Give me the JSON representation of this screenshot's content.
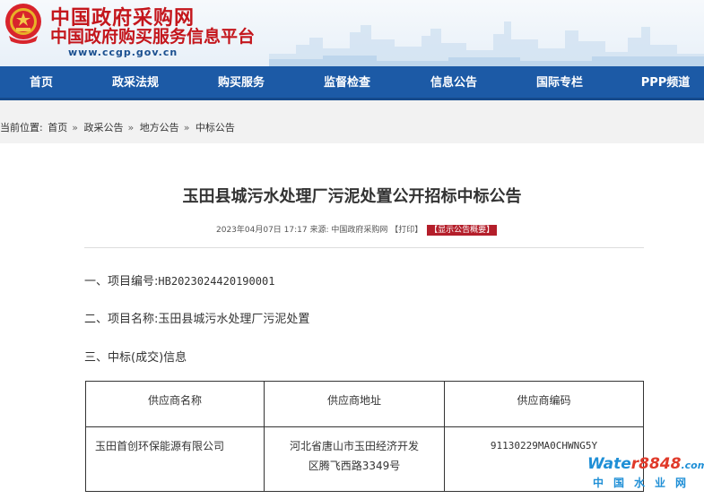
{
  "site": {
    "title_line1": "中国政府采购网",
    "title_line2": "中国政府购买服务信息平台",
    "url": "www.ccgp.gov.cn"
  },
  "nav": [
    {
      "label": "首页",
      "name": "nav-home"
    },
    {
      "label": "政采法规",
      "name": "nav-regulations"
    },
    {
      "label": "购买服务",
      "name": "nav-purchase-services"
    },
    {
      "label": "监督检查",
      "name": "nav-supervision"
    },
    {
      "label": "信息公告",
      "name": "nav-announcements"
    },
    {
      "label": "国际专栏",
      "name": "nav-international"
    },
    {
      "label": "PPP频道",
      "name": "nav-ppp"
    }
  ],
  "breadcrumb": {
    "prefix": "当前位置:",
    "items": [
      "首页",
      "政采公告",
      "地方公告",
      "中标公告"
    ],
    "sep": "»"
  },
  "article": {
    "title": "玉田县城污水处理厂污泥处置公开招标中标公告",
    "meta_datetime": "2023年04月07日 17:17",
    "meta_source": "来源: 中国政府采购网",
    "meta_print": "【打印】",
    "meta_badge": "【显示公告概要】",
    "sec1_label": "一、项目编号:",
    "sec1_value": "HB2023024420190001",
    "sec2_label": "二、项目名称:",
    "sec2_value": "玉田县城污水处理厂污泥处置",
    "sec3_label": "三、中标(成交)信息"
  },
  "table": {
    "headers": [
      "供应商名称",
      "供应商地址",
      "供应商编码"
    ],
    "row": {
      "name": "玉田首创环保能源有限公司",
      "address_line1": "河北省唐山市玉田经济开发",
      "address_line2": "区腾飞西路3349号",
      "code": "91130229MA0CHWNG5Y"
    }
  },
  "watermark": {
    "brand_a": "Wate",
    "brand_b": "r",
    "brand_c": "8848",
    "brand_d": ".com",
    "subtitle": "中国水业网"
  },
  "colors": {
    "nav_bg": "#1c5aa6",
    "title_red": "#c4161c",
    "badge_red": "#b41e2a"
  }
}
